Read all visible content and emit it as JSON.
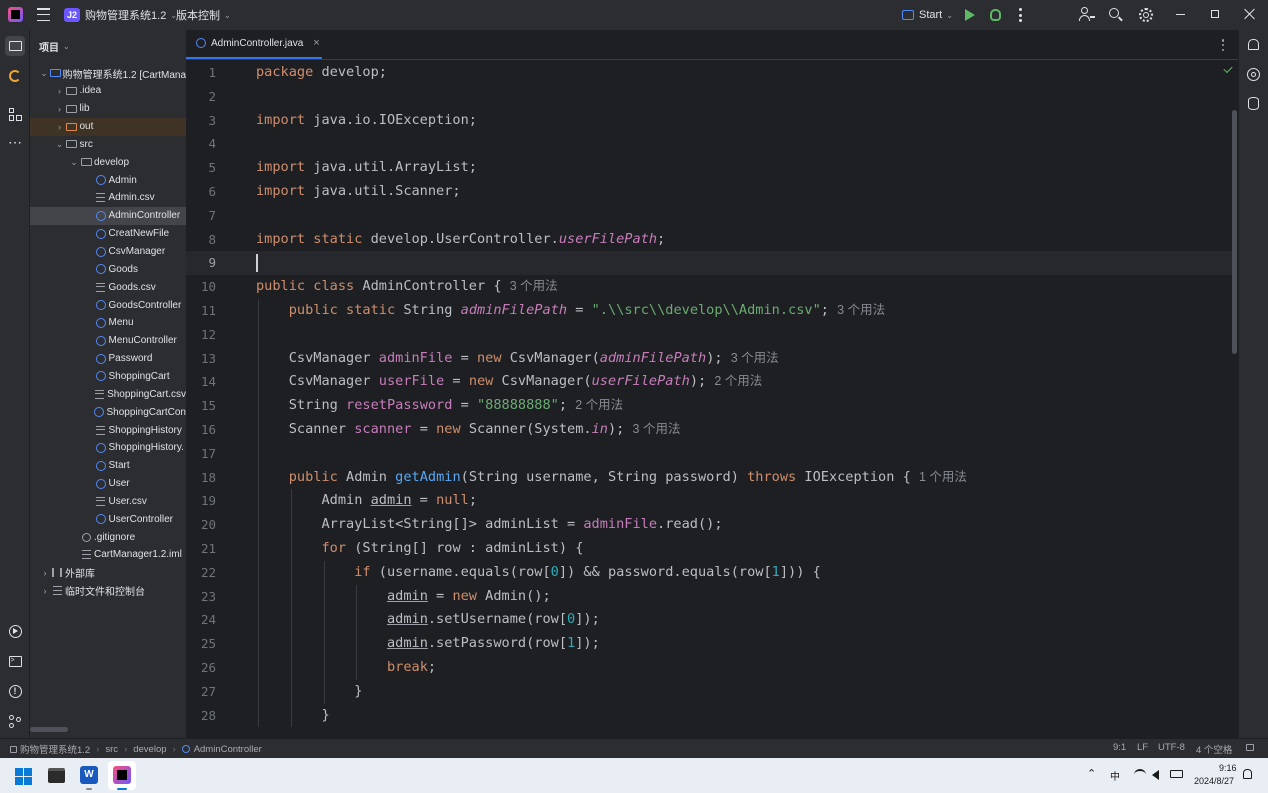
{
  "titlebar": {
    "project_badge": "J2",
    "project_name": "购物管理系统1.2",
    "vcs_label": "版本控制",
    "run_config": "Start"
  },
  "project_panel": {
    "title": "项目",
    "tree": [
      {
        "label": "购物管理系统1.2 [CartMana",
        "indent": 0,
        "type": "module",
        "chev": "v"
      },
      {
        "label": ".idea",
        "indent": 1,
        "type": "folder",
        "chev": ">"
      },
      {
        "label": "lib",
        "indent": 1,
        "type": "folder",
        "chev": ">"
      },
      {
        "label": "out",
        "indent": 1,
        "type": "folder-out",
        "chev": ">"
      },
      {
        "label": "src",
        "indent": 1,
        "type": "folder",
        "chev": "v"
      },
      {
        "label": "develop",
        "indent": 2,
        "type": "package",
        "chev": "v"
      },
      {
        "label": "Admin",
        "indent": 3,
        "type": "class"
      },
      {
        "label": "Admin.csv",
        "indent": 3,
        "type": "file"
      },
      {
        "label": "AdminController",
        "indent": 3,
        "type": "class",
        "selected": true
      },
      {
        "label": "CreatNewFile",
        "indent": 3,
        "type": "class"
      },
      {
        "label": "CsvManager",
        "indent": 3,
        "type": "class"
      },
      {
        "label": "Goods",
        "indent": 3,
        "type": "class"
      },
      {
        "label": "Goods.csv",
        "indent": 3,
        "type": "file"
      },
      {
        "label": "GoodsController",
        "indent": 3,
        "type": "class"
      },
      {
        "label": "Menu",
        "indent": 3,
        "type": "class"
      },
      {
        "label": "MenuController",
        "indent": 3,
        "type": "class"
      },
      {
        "label": "Password",
        "indent": 3,
        "type": "class"
      },
      {
        "label": "ShoppingCart",
        "indent": 3,
        "type": "class"
      },
      {
        "label": "ShoppingCart.csv",
        "indent": 3,
        "type": "file"
      },
      {
        "label": "ShoppingCartCon",
        "indent": 3,
        "type": "class"
      },
      {
        "label": "ShoppingHistory",
        "indent": 3,
        "type": "file"
      },
      {
        "label": "ShoppingHistory.",
        "indent": 3,
        "type": "class"
      },
      {
        "label": "Start",
        "indent": 3,
        "type": "class-run"
      },
      {
        "label": "User",
        "indent": 3,
        "type": "class"
      },
      {
        "label": "User.csv",
        "indent": 3,
        "type": "file"
      },
      {
        "label": "UserController",
        "indent": 3,
        "type": "class"
      },
      {
        "label": ".gitignore",
        "indent": 2,
        "type": "ignore"
      },
      {
        "label": "CartManager1.2.iml",
        "indent": 2,
        "type": "file"
      },
      {
        "label": "外部库",
        "indent": 0,
        "type": "lib",
        "chev": ">"
      },
      {
        "label": "临时文件和控制台",
        "indent": 0,
        "type": "scratch",
        "chev": ">"
      }
    ]
  },
  "editor": {
    "tab_label": "AdminController.java",
    "current_line": 9,
    "line_numbers": [
      "1",
      "2",
      "3",
      "4",
      "5",
      "6",
      "7",
      "8",
      "9",
      "10",
      "11",
      "12",
      "13",
      "14",
      "15",
      "16",
      "17",
      "18",
      "19",
      "20",
      "21",
      "22",
      "23",
      "24",
      "25",
      "26",
      "27",
      "28"
    ],
    "lines": [
      [
        [
          "kw",
          "package"
        ],
        [
          "t",
          " develop;"
        ]
      ],
      [],
      [
        [
          "kw",
          "import"
        ],
        [
          "t",
          " java.io.IOException;"
        ]
      ],
      [],
      [
        [
          "kw",
          "import"
        ],
        [
          "t",
          " java.util.ArrayList;"
        ]
      ],
      [
        [
          "kw",
          "import"
        ],
        [
          "t",
          " java.util.Scanner;"
        ]
      ],
      [],
      [
        [
          "kw",
          "import static"
        ],
        [
          "t",
          " develop.UserController."
        ],
        [
          "st",
          "userFilePath"
        ],
        [
          "t",
          ";"
        ]
      ],
      [],
      [
        [
          "kw",
          "public class"
        ],
        [
          "t",
          " AdminController { "
        ],
        [
          "hint",
          "3 个用法"
        ]
      ],
      [
        [
          "t",
          "    "
        ],
        [
          "kw",
          "public static"
        ],
        [
          "t",
          " String "
        ],
        [
          "st",
          "adminFilePath"
        ],
        [
          "t",
          " = "
        ],
        [
          "str",
          "\".\\\\src\\\\develop\\\\Admin.csv\""
        ],
        [
          "t",
          "; "
        ],
        [
          "hint",
          "3 个用法"
        ]
      ],
      [],
      [
        [
          "t",
          "    CsvManager "
        ],
        [
          "fld",
          "adminFile"
        ],
        [
          "t",
          " = "
        ],
        [
          "kw",
          "new"
        ],
        [
          "t",
          " CsvManager("
        ],
        [
          "st",
          "adminFilePath"
        ],
        [
          "t",
          "); "
        ],
        [
          "hint",
          "3 个用法"
        ]
      ],
      [
        [
          "t",
          "    CsvManager "
        ],
        [
          "fld",
          "userFile"
        ],
        [
          "t",
          " = "
        ],
        [
          "kw",
          "new"
        ],
        [
          "t",
          " CsvManager("
        ],
        [
          "st",
          "userFilePath"
        ],
        [
          "t",
          "); "
        ],
        [
          "hint",
          "2 个用法"
        ]
      ],
      [
        [
          "t",
          "    String "
        ],
        [
          "fld",
          "resetPassword"
        ],
        [
          "t",
          " = "
        ],
        [
          "str",
          "\"88888888\""
        ],
        [
          "t",
          "; "
        ],
        [
          "hint",
          "2 个用法"
        ]
      ],
      [
        [
          "t",
          "    Scanner "
        ],
        [
          "fld",
          "scanner"
        ],
        [
          "t",
          " = "
        ],
        [
          "kw",
          "new"
        ],
        [
          "t",
          " Scanner(System."
        ],
        [
          "st",
          "in"
        ],
        [
          "t",
          "); "
        ],
        [
          "hint",
          "3 个用法"
        ]
      ],
      [],
      [
        [
          "t",
          "    "
        ],
        [
          "kw",
          "public"
        ],
        [
          "t",
          " Admin "
        ],
        [
          "fn",
          "getAdmin"
        ],
        [
          "t",
          "(String username, String password) "
        ],
        [
          "kw",
          "throws"
        ],
        [
          "t",
          " IOException { "
        ],
        [
          "hint",
          "1 个用法"
        ]
      ],
      [
        [
          "t",
          "        Admin "
        ],
        [
          "ul",
          "admin"
        ],
        [
          "t",
          " = "
        ],
        [
          "kw",
          "null"
        ],
        [
          "t",
          ";"
        ]
      ],
      [
        [
          "t",
          "        ArrayList<String[]> adminList = "
        ],
        [
          "fld",
          "adminFile"
        ],
        [
          "t",
          ".read();"
        ]
      ],
      [
        [
          "t",
          "        "
        ],
        [
          "kw",
          "for"
        ],
        [
          "t",
          " (String[] row : adminList) {"
        ]
      ],
      [
        [
          "t",
          "            "
        ],
        [
          "kw",
          "if"
        ],
        [
          "t",
          " (username.equals(row["
        ],
        [
          "num",
          "0"
        ],
        [
          "t",
          "]) && password.equals(row["
        ],
        [
          "num",
          "1"
        ],
        [
          "t",
          "])) {"
        ]
      ],
      [
        [
          "t",
          "                "
        ],
        [
          "ul",
          "admin"
        ],
        [
          "t",
          " = "
        ],
        [
          "kw",
          "new"
        ],
        [
          "t",
          " Admin();"
        ]
      ],
      [
        [
          "t",
          "                "
        ],
        [
          "ul",
          "admin"
        ],
        [
          "t",
          ".setUsername(row["
        ],
        [
          "num",
          "0"
        ],
        [
          "t",
          "]);"
        ]
      ],
      [
        [
          "t",
          "                "
        ],
        [
          "ul",
          "admin"
        ],
        [
          "t",
          ".setPassword(row["
        ],
        [
          "num",
          "1"
        ],
        [
          "t",
          "]);"
        ]
      ],
      [
        [
          "t",
          "                "
        ],
        [
          "kw",
          "break"
        ],
        [
          "t",
          ";"
        ]
      ],
      [
        [
          "t",
          "            }"
        ]
      ],
      [
        [
          "t",
          "        }"
        ]
      ]
    ]
  },
  "statusbar": {
    "breadcrumb": [
      "购物管理系统1.2",
      "src",
      "develop",
      "AdminController"
    ],
    "position": "9:1",
    "line_sep": "LF",
    "encoding": "UTF-8",
    "indent": "4 个空格"
  },
  "taskbar": {
    "ime": "中",
    "time": "9:16",
    "date": "2024/8/27"
  },
  "colors": {
    "keyword": "#cf8e6d",
    "string": "#6aab73",
    "function": "#56a8f5",
    "field": "#c77dbb",
    "number": "#2aacb8",
    "accent": "#3574f0"
  }
}
